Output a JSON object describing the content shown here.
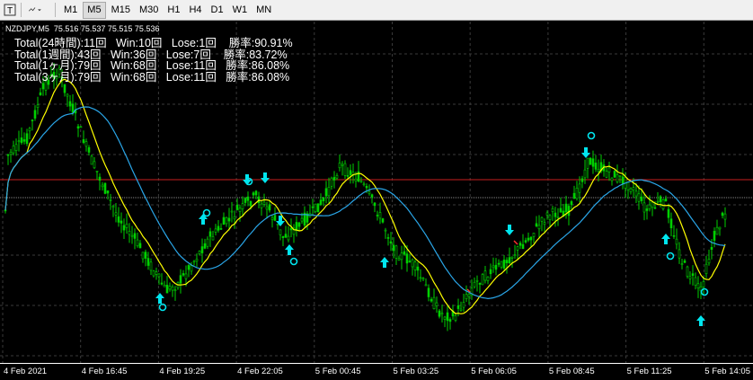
{
  "toolbar": {
    "timeframes": [
      "M1",
      "M5",
      "M15",
      "M30",
      "H1",
      "H4",
      "D1",
      "W1",
      "MN"
    ],
    "active_timeframe": "M5",
    "left_icons": [
      "text-tool-icon",
      "objects-dropdown-icon"
    ]
  },
  "chart": {
    "symbol_info": "NZDJPY,M5  75.516 75.537 75.515 75.536",
    "stats": [
      "Total(24時間):11回   Win:10回   Lose:1回    勝率:90.91%",
      "Total(1週間):43回   Win:36回   Lose:7回    勝率:83.72%",
      "Total(1ヶ月):79回   Win:68回   Lose:11回   勝率:86.08%",
      "Total(3ヶ月):79回   Win:68回   Lose:11回   勝率:86.08%"
    ],
    "time_labels": [
      "4 Feb 2021",
      "4 Feb 16:45",
      "4 Feb 19:25",
      "4 Feb 22:05",
      "5 Feb 00:45",
      "5 Feb 03:25",
      "5 Feb 06:05",
      "5 Feb 08:45",
      "5 Feb 11:25",
      "5 Feb 14:05"
    ],
    "colors": {
      "background": "#000000",
      "grid": "#3a3a3a",
      "candle": "#00d000",
      "fast_ma": "#ffff00",
      "slow_ma": "#2aa6e8",
      "signal": "#00e5ee",
      "level_line": "#c81e1e",
      "price_line": "#b4b4b4"
    }
  }
}
